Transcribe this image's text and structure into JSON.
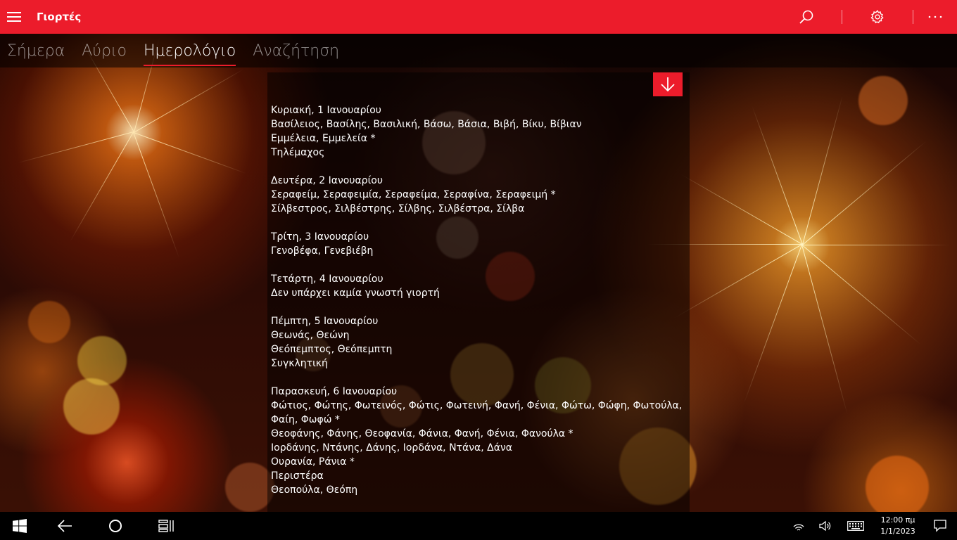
{
  "app": {
    "title": "Γιορτές"
  },
  "pivot": {
    "tabs": [
      {
        "label": "Σήμερα"
      },
      {
        "label": "Αύριο"
      },
      {
        "label": "Ημερολόγιο"
      },
      {
        "label": "Αναζήτηση"
      }
    ],
    "active_tab": "Ημερολόγιο"
  },
  "colors": {
    "accent": "#ec1c2b",
    "taskbar": "#000000"
  },
  "icons": {
    "menu": "hamburger-icon",
    "search": "search-icon",
    "settings": "gear-icon",
    "more": "more-icon",
    "download": "arrow-down-icon"
  },
  "calendar": {
    "days": [
      {
        "date": "Κυριακή, 1 Ιανουαρίου",
        "names": [
          "Βασίλειος, Βασίλης, Βασιλική, Βάσω, Βάσια, Βιβή, Βίκυ, Βίβιαν",
          "Εμμέλεια, Εμμελεία *",
          "Τηλέμαχος"
        ]
      },
      {
        "date": "Δευτέρα, 2 Ιανουαρίου",
        "names": [
          "Σεραφείμ, Σεραφειμία, Σεραφείμα, Σεραφίνα, Σεραφειμή *",
          "Σίλβεστρος, Σιλβέστρης, Σίλβης, Σιλβέστρα, Σίλβα"
        ]
      },
      {
        "date": "Τρίτη, 3 Ιανουαρίου",
        "names": [
          "Γενοβέφα, Γενεβιέβη"
        ]
      },
      {
        "date": "Τετάρτη, 4 Ιανουαρίου",
        "names": [
          "Δεν υπάρχει καμία γνωστή γιορτή"
        ]
      },
      {
        "date": "Πέμπτη, 5 Ιανουαρίου",
        "names": [
          "Θεωνάς, Θεώνη",
          "Θεόπεμπτος, Θεόπεμπτη",
          "Συγκλητική"
        ]
      },
      {
        "date": "Παρασκευή, 6 Ιανουαρίου",
        "names": [
          "Φώτιος, Φώτης, Φωτεινός, Φώτις, Φωτεινή, Φανή, Φένια, Φώτω, Φώφη, Φωτούλα, Φαίη, Φωφώ *",
          "Θεοφάνης, Φάνης, Θεοφανία, Φάνια, Φανή, Φένια, Φανούλα *",
          "Ιορδάνης, Ντάνης, Δάνης, Ιορδάνα, Ντάνα, Δάνα",
          "Ουρανία, Ράνια *",
          "Περιστέρα",
          "Θεοπούλα, Θεόπη"
        ]
      }
    ]
  },
  "taskbar": {
    "clock_time": "12:00 πμ",
    "clock_date": "1/1/2023",
    "icons": [
      "windows-start-icon",
      "back-arrow-icon",
      "cortana-circle-icon",
      "task-view-icon",
      "wifi-icon",
      "volume-icon",
      "keyboard-icon",
      "notification-icon"
    ]
  }
}
